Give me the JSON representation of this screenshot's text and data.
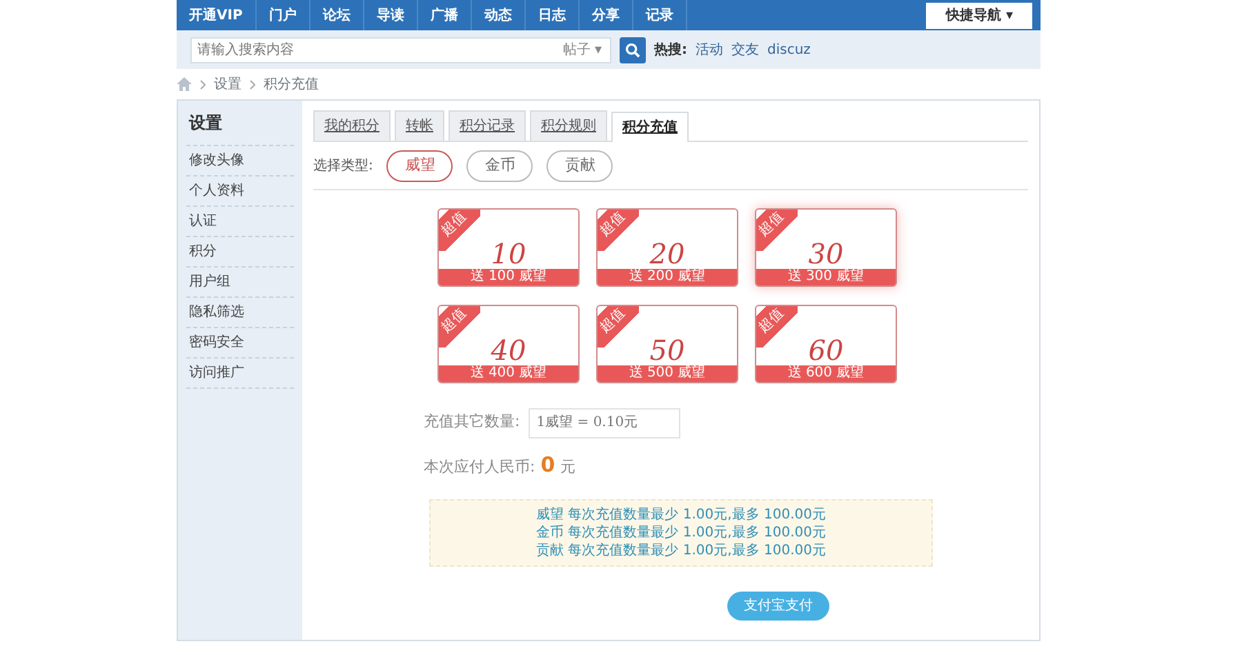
{
  "top_nav": {
    "items": [
      "开通VIP",
      "门户",
      "论坛",
      "导读",
      "广播",
      "动态",
      "日志",
      "分享",
      "记录"
    ],
    "quick_nav": "快捷导航",
    "quick_nav_caret": "▾"
  },
  "search": {
    "placeholder": "请输入搜索内容",
    "scope": "帖子",
    "scope_caret": "▾",
    "hot_label": "热搜:",
    "hot": [
      "活动",
      "交友",
      "discuz"
    ]
  },
  "breadcrumb": [
    "设置",
    "积分充值"
  ],
  "sidebar": {
    "title": "设置",
    "items": [
      "修改头像",
      "个人资料",
      "认证",
      "积分",
      "用户组",
      "隐私筛选",
      "密码安全",
      "访问推广"
    ]
  },
  "tabs": [
    {
      "label": "我的积分",
      "selected": false
    },
    {
      "label": "转帐",
      "selected": false
    },
    {
      "label": "积分记录",
      "selected": false
    },
    {
      "label": "积分规则",
      "selected": false
    },
    {
      "label": "积分充值",
      "selected": true
    }
  ],
  "type_label": "选择类型:",
  "types": [
    {
      "label": "威望",
      "selected": true
    },
    {
      "label": "金币",
      "selected": false
    },
    {
      "label": "贡献",
      "selected": false
    }
  ],
  "packs": [
    {
      "ribbon": "超值",
      "amount": "10",
      "bonus": "送 100 威望",
      "selected": false
    },
    {
      "ribbon": "超值",
      "amount": "20",
      "bonus": "送 200 威望",
      "selected": false
    },
    {
      "ribbon": "超值",
      "amount": "30",
      "bonus": "送 300 威望",
      "selected": true
    },
    {
      "ribbon": "超值",
      "amount": "40",
      "bonus": "送 400 威望",
      "selected": false
    },
    {
      "ribbon": "超值",
      "amount": "50",
      "bonus": "送 500 威望",
      "selected": false
    },
    {
      "ribbon": "超值",
      "amount": "60",
      "bonus": "送 600 威望",
      "selected": false
    }
  ],
  "other_amount": {
    "label": "充值其它数量:",
    "placeholder": "1威望 = 0.10元"
  },
  "total": {
    "label": "本次应付人民币:",
    "value": "0",
    "unit": "元"
  },
  "limits": [
    "威望 每次充值数量最少 1.00元,最多 100.00元",
    "金币 每次充值数量最少 1.00元,最多 100.00元",
    "贡献 每次充值数量最少 1.00元,最多 100.00元"
  ],
  "pay_button": "支付宝支付"
}
